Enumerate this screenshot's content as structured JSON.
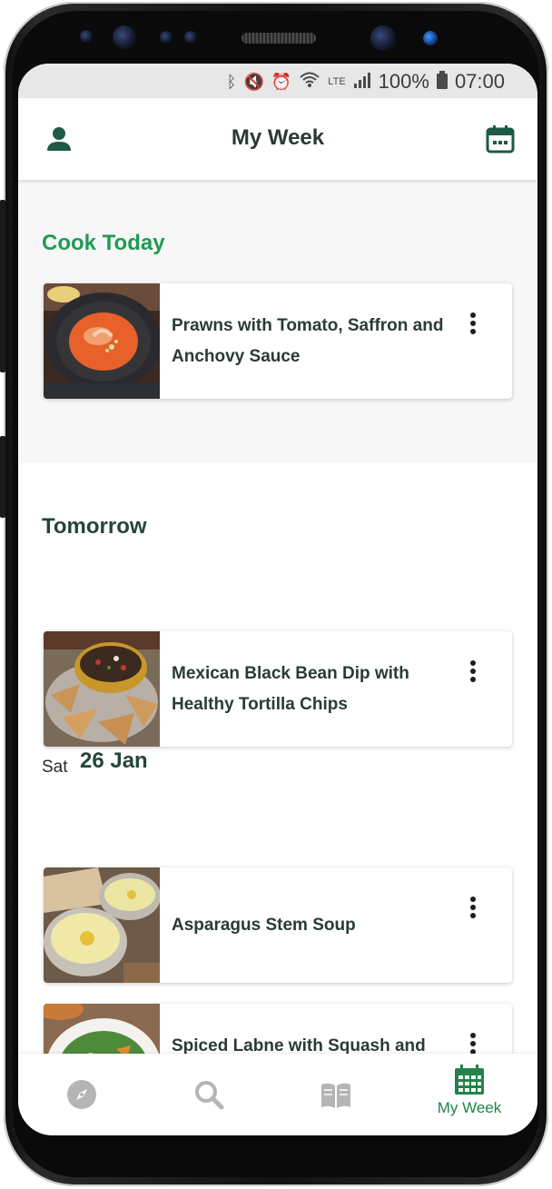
{
  "status_bar": {
    "battery": "100%",
    "time": "07:00",
    "network": "LTE"
  },
  "header": {
    "title": "My Week",
    "left_icon": "user-icon",
    "right_icon": "calendar-icon"
  },
  "sections": {
    "today": {
      "title": "Cook Today",
      "recipes": [
        {
          "title": "Prawns with Tomato, Saffron and Anchovy Sauce"
        }
      ]
    },
    "tomorrow": {
      "title": "Tomorrow",
      "recipes": [
        {
          "title": "Mexican Black Bean Dip with Healthy Tortilla Chips"
        }
      ]
    },
    "saturday": {
      "weekday": "Sat",
      "date": "26 Jan",
      "recipes": [
        {
          "title": "Asparagus Stem Soup"
        },
        {
          "title": "Spiced Labne with Squash and Rocket Salad"
        }
      ]
    }
  },
  "bottom_nav": {
    "items": [
      {
        "icon": "compass-icon",
        "label": ""
      },
      {
        "icon": "search-icon",
        "label": ""
      },
      {
        "icon": "book-icon",
        "label": ""
      },
      {
        "icon": "calendar-grid-icon",
        "label": "My Week"
      }
    ],
    "active_index": 3
  },
  "colors": {
    "accent_green": "#1f9a55",
    "dark_green": "#24453a",
    "nav_inactive": "#b0b0b0",
    "status_bar_bg": "#e7e7e7"
  }
}
